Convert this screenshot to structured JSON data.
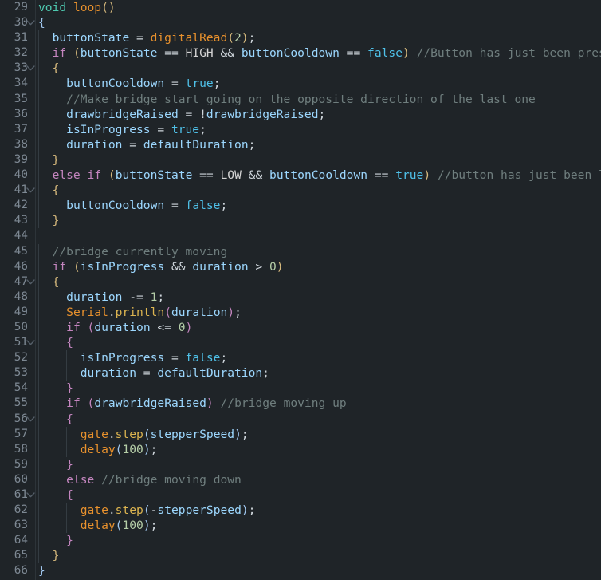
{
  "editor": {
    "language": "arduino-cpp",
    "first_line": 29,
    "last_line": 66,
    "theme": "dark",
    "background_color": "#1f2428",
    "gutter_color": "#7d8893",
    "fold_icon": "chevron-down-icon"
  },
  "colors": {
    "type": "#4ec9b0",
    "function": "#e8912d",
    "method": "#dcb450",
    "variable": "#9cd7fe",
    "keyword": "#c586c0",
    "boolean": "#4fc1e9",
    "constant": "#d4d4d4",
    "number": "#b5cea8",
    "comment": "#6f7e7e",
    "operator": "#cfd6dc",
    "bracket_0": "#a1c8f0",
    "bracket_1": "#d7ba7d",
    "bracket_2": "#c586c0"
  },
  "lines": [
    {
      "n": 29,
      "fold": false,
      "indent": 0,
      "text": "void loop()",
      "tokens": [
        {
          "t": "void",
          "c": "t-type"
        },
        {
          "t": " ",
          "c": "t-op"
        },
        {
          "t": "loop",
          "c": "t-fn"
        },
        {
          "t": "(",
          "c": "b-1"
        },
        {
          "t": ")",
          "c": "b-1"
        }
      ]
    },
    {
      "n": 30,
      "fold": true,
      "indent": 0,
      "text": "{",
      "tokens": [
        {
          "t": "{",
          "c": "b-0"
        }
      ]
    },
    {
      "n": 31,
      "fold": false,
      "indent": 1,
      "text": "  buttonState = digitalRead(2);",
      "tokens": [
        {
          "t": "  ",
          "c": "t-op"
        },
        {
          "t": "buttonState",
          "c": "t-var"
        },
        {
          "t": " = ",
          "c": "t-op"
        },
        {
          "t": "digitalRead",
          "c": "t-fn"
        },
        {
          "t": "(",
          "c": "b-1"
        },
        {
          "t": "2",
          "c": "t-num"
        },
        {
          "t": ")",
          "c": "b-1"
        },
        {
          "t": ";",
          "c": "t-punc"
        }
      ]
    },
    {
      "n": 32,
      "fold": false,
      "indent": 1,
      "text": "  if (buttonState == HIGH && buttonCooldown == false) //Button has just been pressed",
      "tokens": [
        {
          "t": "  ",
          "c": "t-op"
        },
        {
          "t": "if",
          "c": "t-kw"
        },
        {
          "t": " ",
          "c": "t-op"
        },
        {
          "t": "(",
          "c": "b-1"
        },
        {
          "t": "buttonState",
          "c": "t-var"
        },
        {
          "t": " == ",
          "c": "t-op"
        },
        {
          "t": "HIGH",
          "c": "t-const"
        },
        {
          "t": " && ",
          "c": "t-op"
        },
        {
          "t": "buttonCooldown",
          "c": "t-var"
        },
        {
          "t": " == ",
          "c": "t-op"
        },
        {
          "t": "false",
          "c": "t-bool"
        },
        {
          "t": ")",
          "c": "b-1"
        },
        {
          "t": " ",
          "c": "t-op"
        },
        {
          "t": "//Button has just been pressed",
          "c": "t-cmt"
        }
      ]
    },
    {
      "n": 33,
      "fold": true,
      "indent": 1,
      "text": "  {",
      "tokens": [
        {
          "t": "  ",
          "c": "t-op"
        },
        {
          "t": "{",
          "c": "b-1"
        }
      ]
    },
    {
      "n": 34,
      "fold": false,
      "indent": 2,
      "text": "    buttonCooldown = true;",
      "tokens": [
        {
          "t": "    ",
          "c": "t-op"
        },
        {
          "t": "buttonCooldown",
          "c": "t-var"
        },
        {
          "t": " = ",
          "c": "t-op"
        },
        {
          "t": "true",
          "c": "t-bool"
        },
        {
          "t": ";",
          "c": "t-punc"
        }
      ]
    },
    {
      "n": 35,
      "fold": false,
      "indent": 2,
      "text": "    //Make bridge start going on the opposite direction of the last one",
      "tokens": [
        {
          "t": "    ",
          "c": "t-op"
        },
        {
          "t": "//Make bridge start going on the opposite direction of the last one",
          "c": "t-cmt"
        }
      ]
    },
    {
      "n": 36,
      "fold": false,
      "indent": 2,
      "text": "    drawbridgeRaised = !drawbridgeRaised;",
      "tokens": [
        {
          "t": "    ",
          "c": "t-op"
        },
        {
          "t": "drawbridgeRaised",
          "c": "t-var"
        },
        {
          "t": " = ",
          "c": "t-op"
        },
        {
          "t": "!",
          "c": "t-op"
        },
        {
          "t": "drawbridgeRaised",
          "c": "t-var"
        },
        {
          "t": ";",
          "c": "t-punc"
        }
      ]
    },
    {
      "n": 37,
      "fold": false,
      "indent": 2,
      "text": "    isInProgress = true;",
      "tokens": [
        {
          "t": "    ",
          "c": "t-op"
        },
        {
          "t": "isInProgress",
          "c": "t-var"
        },
        {
          "t": " = ",
          "c": "t-op"
        },
        {
          "t": "true",
          "c": "t-bool"
        },
        {
          "t": ";",
          "c": "t-punc"
        }
      ]
    },
    {
      "n": 38,
      "fold": false,
      "indent": 2,
      "text": "    duration = defaultDuration;",
      "tokens": [
        {
          "t": "    ",
          "c": "t-op"
        },
        {
          "t": "duration",
          "c": "t-var"
        },
        {
          "t": " = ",
          "c": "t-op"
        },
        {
          "t": "defaultDuration",
          "c": "t-var"
        },
        {
          "t": ";",
          "c": "t-punc"
        }
      ]
    },
    {
      "n": 39,
      "fold": false,
      "indent": 1,
      "text": "  }",
      "tokens": [
        {
          "t": "  ",
          "c": "t-op"
        },
        {
          "t": "}",
          "c": "b-1"
        }
      ]
    },
    {
      "n": 40,
      "fold": false,
      "indent": 1,
      "text": "  else if (buttonState == LOW && buttonCooldown == true) //button has just been let go of",
      "tokens": [
        {
          "t": "  ",
          "c": "t-op"
        },
        {
          "t": "else",
          "c": "t-kw"
        },
        {
          "t": " ",
          "c": "t-op"
        },
        {
          "t": "if",
          "c": "t-kw"
        },
        {
          "t": " ",
          "c": "t-op"
        },
        {
          "t": "(",
          "c": "b-1"
        },
        {
          "t": "buttonState",
          "c": "t-var"
        },
        {
          "t": " == ",
          "c": "t-op"
        },
        {
          "t": "LOW",
          "c": "t-const"
        },
        {
          "t": " && ",
          "c": "t-op"
        },
        {
          "t": "buttonCooldown",
          "c": "t-var"
        },
        {
          "t": " == ",
          "c": "t-op"
        },
        {
          "t": "true",
          "c": "t-bool"
        },
        {
          "t": ")",
          "c": "b-1"
        },
        {
          "t": " ",
          "c": "t-op"
        },
        {
          "t": "//button has just been let go of",
          "c": "t-cmt"
        }
      ]
    },
    {
      "n": 41,
      "fold": true,
      "indent": 1,
      "text": "  {",
      "tokens": [
        {
          "t": "  ",
          "c": "t-op"
        },
        {
          "t": "{",
          "c": "b-1"
        }
      ]
    },
    {
      "n": 42,
      "fold": false,
      "indent": 2,
      "text": "    buttonCooldown = false;",
      "tokens": [
        {
          "t": "    ",
          "c": "t-op"
        },
        {
          "t": "buttonCooldown",
          "c": "t-var"
        },
        {
          "t": " = ",
          "c": "t-op"
        },
        {
          "t": "false",
          "c": "t-bool"
        },
        {
          "t": ";",
          "c": "t-punc"
        }
      ]
    },
    {
      "n": 43,
      "fold": false,
      "indent": 1,
      "text": "  }",
      "tokens": [
        {
          "t": "  ",
          "c": "t-op"
        },
        {
          "t": "}",
          "c": "b-1"
        }
      ]
    },
    {
      "n": 44,
      "fold": false,
      "indent": 0,
      "text": "",
      "tokens": []
    },
    {
      "n": 45,
      "fold": false,
      "indent": 1,
      "text": "  //bridge currently moving",
      "tokens": [
        {
          "t": "  ",
          "c": "t-op"
        },
        {
          "t": "//bridge currently moving",
          "c": "t-cmt"
        }
      ]
    },
    {
      "n": 46,
      "fold": false,
      "indent": 1,
      "text": "  if (isInProgress && duration > 0)",
      "tokens": [
        {
          "t": "  ",
          "c": "t-op"
        },
        {
          "t": "if",
          "c": "t-kw"
        },
        {
          "t": " ",
          "c": "t-op"
        },
        {
          "t": "(",
          "c": "b-1"
        },
        {
          "t": "isInProgress",
          "c": "t-var"
        },
        {
          "t": " && ",
          "c": "t-op"
        },
        {
          "t": "duration",
          "c": "t-var"
        },
        {
          "t": " > ",
          "c": "t-op"
        },
        {
          "t": "0",
          "c": "t-num"
        },
        {
          "t": ")",
          "c": "b-1"
        }
      ]
    },
    {
      "n": 47,
      "fold": true,
      "indent": 1,
      "text": "  {",
      "tokens": [
        {
          "t": "  ",
          "c": "t-op"
        },
        {
          "t": "{",
          "c": "b-1"
        }
      ]
    },
    {
      "n": 48,
      "fold": false,
      "indent": 2,
      "text": "    duration -= 1;",
      "tokens": [
        {
          "t": "    ",
          "c": "t-op"
        },
        {
          "t": "duration",
          "c": "t-var"
        },
        {
          "t": " -= ",
          "c": "t-op"
        },
        {
          "t": "1",
          "c": "t-num"
        },
        {
          "t": ";",
          "c": "t-punc"
        }
      ]
    },
    {
      "n": 49,
      "fold": false,
      "indent": 2,
      "text": "    Serial.println(duration);",
      "tokens": [
        {
          "t": "    ",
          "c": "t-op"
        },
        {
          "t": "Serial",
          "c": "t-fn"
        },
        {
          "t": ".",
          "c": "t-op"
        },
        {
          "t": "println",
          "c": "t-method"
        },
        {
          "t": "(",
          "c": "b-2"
        },
        {
          "t": "duration",
          "c": "t-var"
        },
        {
          "t": ")",
          "c": "b-2"
        },
        {
          "t": ";",
          "c": "t-punc"
        }
      ]
    },
    {
      "n": 50,
      "fold": false,
      "indent": 2,
      "text": "    if (duration <= 0)",
      "tokens": [
        {
          "t": "    ",
          "c": "t-op"
        },
        {
          "t": "if",
          "c": "t-kw"
        },
        {
          "t": " ",
          "c": "t-op"
        },
        {
          "t": "(",
          "c": "b-2"
        },
        {
          "t": "duration",
          "c": "t-var"
        },
        {
          "t": " <= ",
          "c": "t-op"
        },
        {
          "t": "0",
          "c": "t-num"
        },
        {
          "t": ")",
          "c": "b-2"
        }
      ]
    },
    {
      "n": 51,
      "fold": true,
      "indent": 2,
      "text": "    {",
      "tokens": [
        {
          "t": "    ",
          "c": "t-op"
        },
        {
          "t": "{",
          "c": "b-2"
        }
      ]
    },
    {
      "n": 52,
      "fold": false,
      "indent": 3,
      "text": "      isInProgress = false;",
      "tokens": [
        {
          "t": "      ",
          "c": "t-op"
        },
        {
          "t": "isInProgress",
          "c": "t-var"
        },
        {
          "t": " = ",
          "c": "t-op"
        },
        {
          "t": "false",
          "c": "t-bool"
        },
        {
          "t": ";",
          "c": "t-punc"
        }
      ]
    },
    {
      "n": 53,
      "fold": false,
      "indent": 3,
      "text": "      duration = defaultDuration;",
      "tokens": [
        {
          "t": "      ",
          "c": "t-op"
        },
        {
          "t": "duration",
          "c": "t-var"
        },
        {
          "t": " = ",
          "c": "t-op"
        },
        {
          "t": "defaultDuration",
          "c": "t-var"
        },
        {
          "t": ";",
          "c": "t-punc"
        }
      ]
    },
    {
      "n": 54,
      "fold": false,
      "indent": 2,
      "text": "    }",
      "tokens": [
        {
          "t": "    ",
          "c": "t-op"
        },
        {
          "t": "}",
          "c": "b-2"
        }
      ]
    },
    {
      "n": 55,
      "fold": false,
      "indent": 2,
      "text": "    if (drawbridgeRaised) //bridge moving up",
      "tokens": [
        {
          "t": "    ",
          "c": "t-op"
        },
        {
          "t": "if",
          "c": "t-kw"
        },
        {
          "t": " ",
          "c": "t-op"
        },
        {
          "t": "(",
          "c": "b-2"
        },
        {
          "t": "drawbridgeRaised",
          "c": "t-var"
        },
        {
          "t": ")",
          "c": "b-2"
        },
        {
          "t": " ",
          "c": "t-op"
        },
        {
          "t": "//bridge moving up",
          "c": "t-cmt"
        }
      ]
    },
    {
      "n": 56,
      "fold": true,
      "indent": 2,
      "text": "    {",
      "tokens": [
        {
          "t": "    ",
          "c": "t-op"
        },
        {
          "t": "{",
          "c": "b-2"
        }
      ]
    },
    {
      "n": 57,
      "fold": false,
      "indent": 3,
      "text": "      gate.step(stepperSpeed);",
      "tokens": [
        {
          "t": "      ",
          "c": "t-op"
        },
        {
          "t": "gate",
          "c": "t-fn"
        },
        {
          "t": ".",
          "c": "t-op"
        },
        {
          "t": "step",
          "c": "t-method"
        },
        {
          "t": "(",
          "c": "b-3"
        },
        {
          "t": "stepperSpeed",
          "c": "t-var"
        },
        {
          "t": ")",
          "c": "b-3"
        },
        {
          "t": ";",
          "c": "t-punc"
        }
      ]
    },
    {
      "n": 58,
      "fold": false,
      "indent": 3,
      "text": "      delay(100);",
      "tokens": [
        {
          "t": "      ",
          "c": "t-op"
        },
        {
          "t": "delay",
          "c": "t-fn"
        },
        {
          "t": "(",
          "c": "b-3"
        },
        {
          "t": "100",
          "c": "t-num"
        },
        {
          "t": ")",
          "c": "b-3"
        },
        {
          "t": ";",
          "c": "t-punc"
        }
      ]
    },
    {
      "n": 59,
      "fold": false,
      "indent": 2,
      "text": "    }",
      "tokens": [
        {
          "t": "    ",
          "c": "t-op"
        },
        {
          "t": "}",
          "c": "b-2"
        }
      ]
    },
    {
      "n": 60,
      "fold": false,
      "indent": 2,
      "text": "    else //bridge moving down",
      "tokens": [
        {
          "t": "    ",
          "c": "t-op"
        },
        {
          "t": "else",
          "c": "t-kw"
        },
        {
          "t": " ",
          "c": "t-op"
        },
        {
          "t": "//bridge moving down",
          "c": "t-cmt"
        }
      ]
    },
    {
      "n": 61,
      "fold": true,
      "indent": 2,
      "text": "    {",
      "tokens": [
        {
          "t": "    ",
          "c": "t-op"
        },
        {
          "t": "{",
          "c": "b-2"
        }
      ]
    },
    {
      "n": 62,
      "fold": false,
      "indent": 3,
      "text": "      gate.step(-stepperSpeed);",
      "tokens": [
        {
          "t": "      ",
          "c": "t-op"
        },
        {
          "t": "gate",
          "c": "t-fn"
        },
        {
          "t": ".",
          "c": "t-op"
        },
        {
          "t": "step",
          "c": "t-method"
        },
        {
          "t": "(",
          "c": "b-3"
        },
        {
          "t": "-",
          "c": "t-op"
        },
        {
          "t": "stepperSpeed",
          "c": "t-var"
        },
        {
          "t": ")",
          "c": "b-3"
        },
        {
          "t": ";",
          "c": "t-punc"
        }
      ]
    },
    {
      "n": 63,
      "fold": false,
      "indent": 3,
      "text": "      delay(100);",
      "tokens": [
        {
          "t": "      ",
          "c": "t-op"
        },
        {
          "t": "delay",
          "c": "t-fn"
        },
        {
          "t": "(",
          "c": "b-3"
        },
        {
          "t": "100",
          "c": "t-num"
        },
        {
          "t": ")",
          "c": "b-3"
        },
        {
          "t": ";",
          "c": "t-punc"
        }
      ]
    },
    {
      "n": 64,
      "fold": false,
      "indent": 2,
      "text": "    }",
      "tokens": [
        {
          "t": "    ",
          "c": "t-op"
        },
        {
          "t": "}",
          "c": "b-2"
        }
      ]
    },
    {
      "n": 65,
      "fold": false,
      "indent": 1,
      "text": "  }",
      "tokens": [
        {
          "t": "  ",
          "c": "t-op"
        },
        {
          "t": "}",
          "c": "b-1"
        }
      ]
    },
    {
      "n": 66,
      "fold": false,
      "indent": 0,
      "text": "}",
      "tokens": [
        {
          "t": "}",
          "c": "b-0"
        }
      ]
    }
  ]
}
